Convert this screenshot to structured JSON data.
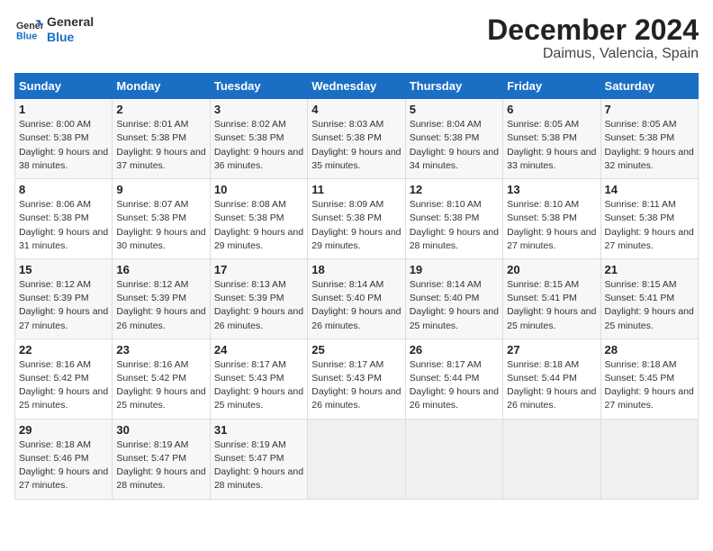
{
  "header": {
    "logo_line1": "General",
    "logo_line2": "Blue",
    "title": "December 2024",
    "subtitle": "Daimus, Valencia, Spain"
  },
  "columns": [
    "Sunday",
    "Monday",
    "Tuesday",
    "Wednesday",
    "Thursday",
    "Friday",
    "Saturday"
  ],
  "weeks": [
    [
      {
        "day": "1",
        "sunrise": "8:00 AM",
        "sunset": "5:38 PM",
        "daylight": "9 hours and 38 minutes."
      },
      {
        "day": "2",
        "sunrise": "8:01 AM",
        "sunset": "5:38 PM",
        "daylight": "9 hours and 37 minutes."
      },
      {
        "day": "3",
        "sunrise": "8:02 AM",
        "sunset": "5:38 PM",
        "daylight": "9 hours and 36 minutes."
      },
      {
        "day": "4",
        "sunrise": "8:03 AM",
        "sunset": "5:38 PM",
        "daylight": "9 hours and 35 minutes."
      },
      {
        "day": "5",
        "sunrise": "8:04 AM",
        "sunset": "5:38 PM",
        "daylight": "9 hours and 34 minutes."
      },
      {
        "day": "6",
        "sunrise": "8:05 AM",
        "sunset": "5:38 PM",
        "daylight": "9 hours and 33 minutes."
      },
      {
        "day": "7",
        "sunrise": "8:05 AM",
        "sunset": "5:38 PM",
        "daylight": "9 hours and 32 minutes."
      }
    ],
    [
      {
        "day": "8",
        "sunrise": "8:06 AM",
        "sunset": "5:38 PM",
        "daylight": "9 hours and 31 minutes."
      },
      {
        "day": "9",
        "sunrise": "8:07 AM",
        "sunset": "5:38 PM",
        "daylight": "9 hours and 30 minutes."
      },
      {
        "day": "10",
        "sunrise": "8:08 AM",
        "sunset": "5:38 PM",
        "daylight": "9 hours and 29 minutes."
      },
      {
        "day": "11",
        "sunrise": "8:09 AM",
        "sunset": "5:38 PM",
        "daylight": "9 hours and 29 minutes."
      },
      {
        "day": "12",
        "sunrise": "8:10 AM",
        "sunset": "5:38 PM",
        "daylight": "9 hours and 28 minutes."
      },
      {
        "day": "13",
        "sunrise": "8:10 AM",
        "sunset": "5:38 PM",
        "daylight": "9 hours and 27 minutes."
      },
      {
        "day": "14",
        "sunrise": "8:11 AM",
        "sunset": "5:38 PM",
        "daylight": "9 hours and 27 minutes."
      }
    ],
    [
      {
        "day": "15",
        "sunrise": "8:12 AM",
        "sunset": "5:39 PM",
        "daylight": "9 hours and 27 minutes."
      },
      {
        "day": "16",
        "sunrise": "8:12 AM",
        "sunset": "5:39 PM",
        "daylight": "9 hours and 26 minutes."
      },
      {
        "day": "17",
        "sunrise": "8:13 AM",
        "sunset": "5:39 PM",
        "daylight": "9 hours and 26 minutes."
      },
      {
        "day": "18",
        "sunrise": "8:14 AM",
        "sunset": "5:40 PM",
        "daylight": "9 hours and 26 minutes."
      },
      {
        "day": "19",
        "sunrise": "8:14 AM",
        "sunset": "5:40 PM",
        "daylight": "9 hours and 25 minutes."
      },
      {
        "day": "20",
        "sunrise": "8:15 AM",
        "sunset": "5:41 PM",
        "daylight": "9 hours and 25 minutes."
      },
      {
        "day": "21",
        "sunrise": "8:15 AM",
        "sunset": "5:41 PM",
        "daylight": "9 hours and 25 minutes."
      }
    ],
    [
      {
        "day": "22",
        "sunrise": "8:16 AM",
        "sunset": "5:42 PM",
        "daylight": "9 hours and 25 minutes."
      },
      {
        "day": "23",
        "sunrise": "8:16 AM",
        "sunset": "5:42 PM",
        "daylight": "9 hours and 25 minutes."
      },
      {
        "day": "24",
        "sunrise": "8:17 AM",
        "sunset": "5:43 PM",
        "daylight": "9 hours and 25 minutes."
      },
      {
        "day": "25",
        "sunrise": "8:17 AM",
        "sunset": "5:43 PM",
        "daylight": "9 hours and 26 minutes."
      },
      {
        "day": "26",
        "sunrise": "8:17 AM",
        "sunset": "5:44 PM",
        "daylight": "9 hours and 26 minutes."
      },
      {
        "day": "27",
        "sunrise": "8:18 AM",
        "sunset": "5:44 PM",
        "daylight": "9 hours and 26 minutes."
      },
      {
        "day": "28",
        "sunrise": "8:18 AM",
        "sunset": "5:45 PM",
        "daylight": "9 hours and 27 minutes."
      }
    ],
    [
      {
        "day": "29",
        "sunrise": "8:18 AM",
        "sunset": "5:46 PM",
        "daylight": "9 hours and 27 minutes."
      },
      {
        "day": "30",
        "sunrise": "8:19 AM",
        "sunset": "5:47 PM",
        "daylight": "9 hours and 28 minutes."
      },
      {
        "day": "31",
        "sunrise": "8:19 AM",
        "sunset": "5:47 PM",
        "daylight": "9 hours and 28 minutes."
      },
      null,
      null,
      null,
      null
    ]
  ]
}
